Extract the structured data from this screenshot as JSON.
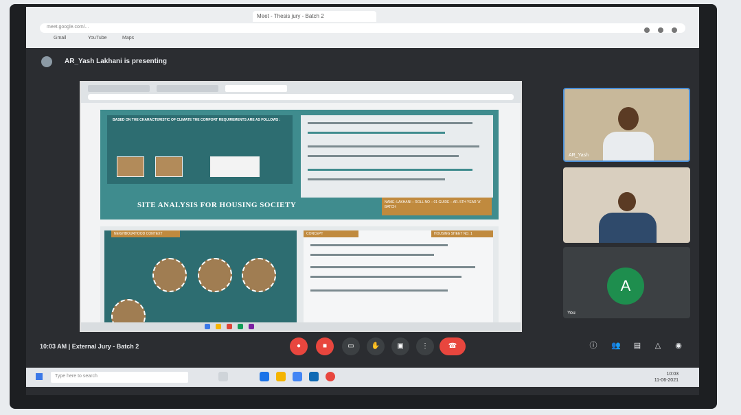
{
  "browser": {
    "tab_title": "Meet - Thesis jury - Batch 2",
    "url": "meet.google.com/...",
    "bookmarks": [
      "Gmail",
      "YouTube",
      "Maps"
    ]
  },
  "presenter": {
    "text": "AR_Yash Lakhani is presenting"
  },
  "shared_screen": {
    "board_heading": "BASED ON THE CHARACTERISTIC OF CLIMATE THE COMFORT REQUIREMENTS ARE AS FOLLOWS :",
    "banner_title": "SITE ANALYSIS FOR HOUSING SOCIETY",
    "banner_info": "NAME: LAKHANI – ROLL NO – 01 GUIDE – AR. 5TH YEAR 'A' BATCH",
    "section_context": "NEIGHBOURHOOD CONTEXT",
    "section_concept": "CONCEPT",
    "section_sheet": "HOUSING SHEET NO. 1"
  },
  "participants": [
    {
      "name": "AR_Yash"
    },
    {
      "name": ""
    },
    {
      "name": "You",
      "initial": "A"
    }
  ],
  "meeting": {
    "time": "10:03 AM",
    "separator": "|",
    "title": "External Jury - Batch 2"
  },
  "controls": {
    "mic": "mic-off-icon",
    "camera": "camera-off-icon",
    "captions": "captions-icon",
    "raise_hand": "hand-icon",
    "present": "present-icon",
    "more": "more-vert-icon",
    "end": "end-call-icon"
  },
  "os": {
    "search_placeholder": "Type here to search",
    "clock_time": "10:03",
    "clock_date": "11-06-2021"
  },
  "colors": {
    "accent_red": "#e8463e",
    "teal": "#3f8c8e",
    "avatar_green": "#1e8e4e",
    "active_border": "#4a8fd8"
  }
}
